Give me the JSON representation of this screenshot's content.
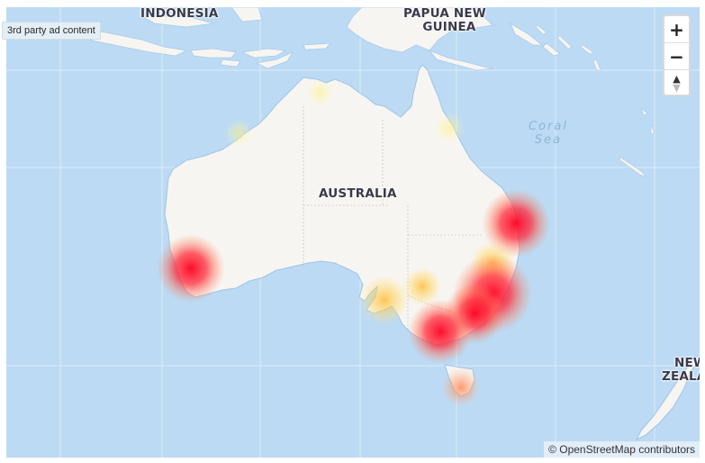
{
  "ad_label": "3rd party ad content",
  "map": {
    "labels": {
      "indonesia": "INDONESIA",
      "papua_line1": "PAPUA NEW",
      "papua_line2": "GUINEA",
      "australia": "AUSTRALIA",
      "coral_line1": "Coral",
      "coral_line2": "Sea",
      "nz_line1": "NEW",
      "nz_line2": "ZEALAND"
    },
    "colors": {
      "water": "#bcdaf3",
      "land": "#f7f5f2",
      "heat_high": "#ff0022",
      "heat_mid": "#ff7a30",
      "heat_low": "#ffd84a"
    },
    "heat_spots": [
      {
        "name": "Perth",
        "intensity": "high"
      },
      {
        "name": "Brisbane",
        "intensity": "high"
      },
      {
        "name": "Sydney",
        "intensity": "high"
      },
      {
        "name": "Canberra",
        "intensity": "high"
      },
      {
        "name": "Melbourne",
        "intensity": "high"
      },
      {
        "name": "Adelaide",
        "intensity": "low"
      },
      {
        "name": "Mildura",
        "intensity": "low"
      },
      {
        "name": "Hobart",
        "intensity": "medium"
      },
      {
        "name": "Darwin",
        "intensity": "very-low"
      },
      {
        "name": "Cairns",
        "intensity": "very-low"
      },
      {
        "name": "Broome",
        "intensity": "very-low"
      }
    ]
  },
  "controls": {
    "zoom_in": "+",
    "zoom_out": "−",
    "reset_north": "▲"
  },
  "attribution": {
    "symbol": "©",
    "text": "OpenStreetMap contributors"
  }
}
